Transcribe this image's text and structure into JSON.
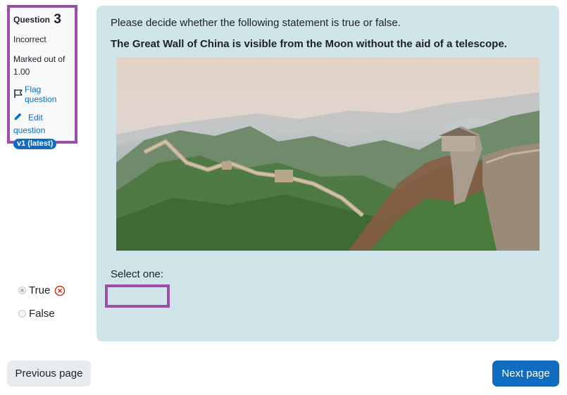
{
  "question_info": {
    "question_label": "Question",
    "question_number": "3",
    "state": "Incorrect",
    "grade": "Marked out of 1.00",
    "flag_label": "Flag question",
    "edit_label": "Edit question",
    "version_badge": "v1 (latest)"
  },
  "question": {
    "prompt": "Please decide whether the following statement is true or false.",
    "statement": "The Great Wall of China is visible from the Moon without the aid of a telescope.",
    "select_label": "Select one:",
    "options": [
      {
        "label": "True",
        "selected": true,
        "feedback": "incorrect"
      },
      {
        "label": "False",
        "selected": false
      }
    ]
  },
  "navigation": {
    "previous_label": "Previous page",
    "next_label": "Next page"
  },
  "colors": {
    "accent": "#0f6cbf",
    "highlight_border": "#9b4fa8",
    "content_background": "#cfe5ea",
    "incorrect": "#ca3120"
  }
}
